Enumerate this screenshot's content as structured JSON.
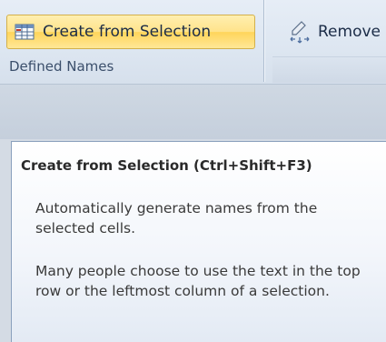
{
  "ribbon": {
    "create_button": {
      "label": "Create from Selection",
      "icon": "create-from-selection-icon"
    },
    "remove_button": {
      "label": "Remove",
      "icon": "remove-arrows-icon"
    },
    "group_title": "Defined Names"
  },
  "tooltip": {
    "title": "Create from Selection (Ctrl+Shift+F3)",
    "paragraph1": "Automatically generate names from the selected cells.",
    "paragraph2": "Many people choose to use the text in the top row or the leftmost column of a selection."
  },
  "colors": {
    "hover_button": "#ffe38a",
    "ribbon_bg": "#dde6f1"
  }
}
